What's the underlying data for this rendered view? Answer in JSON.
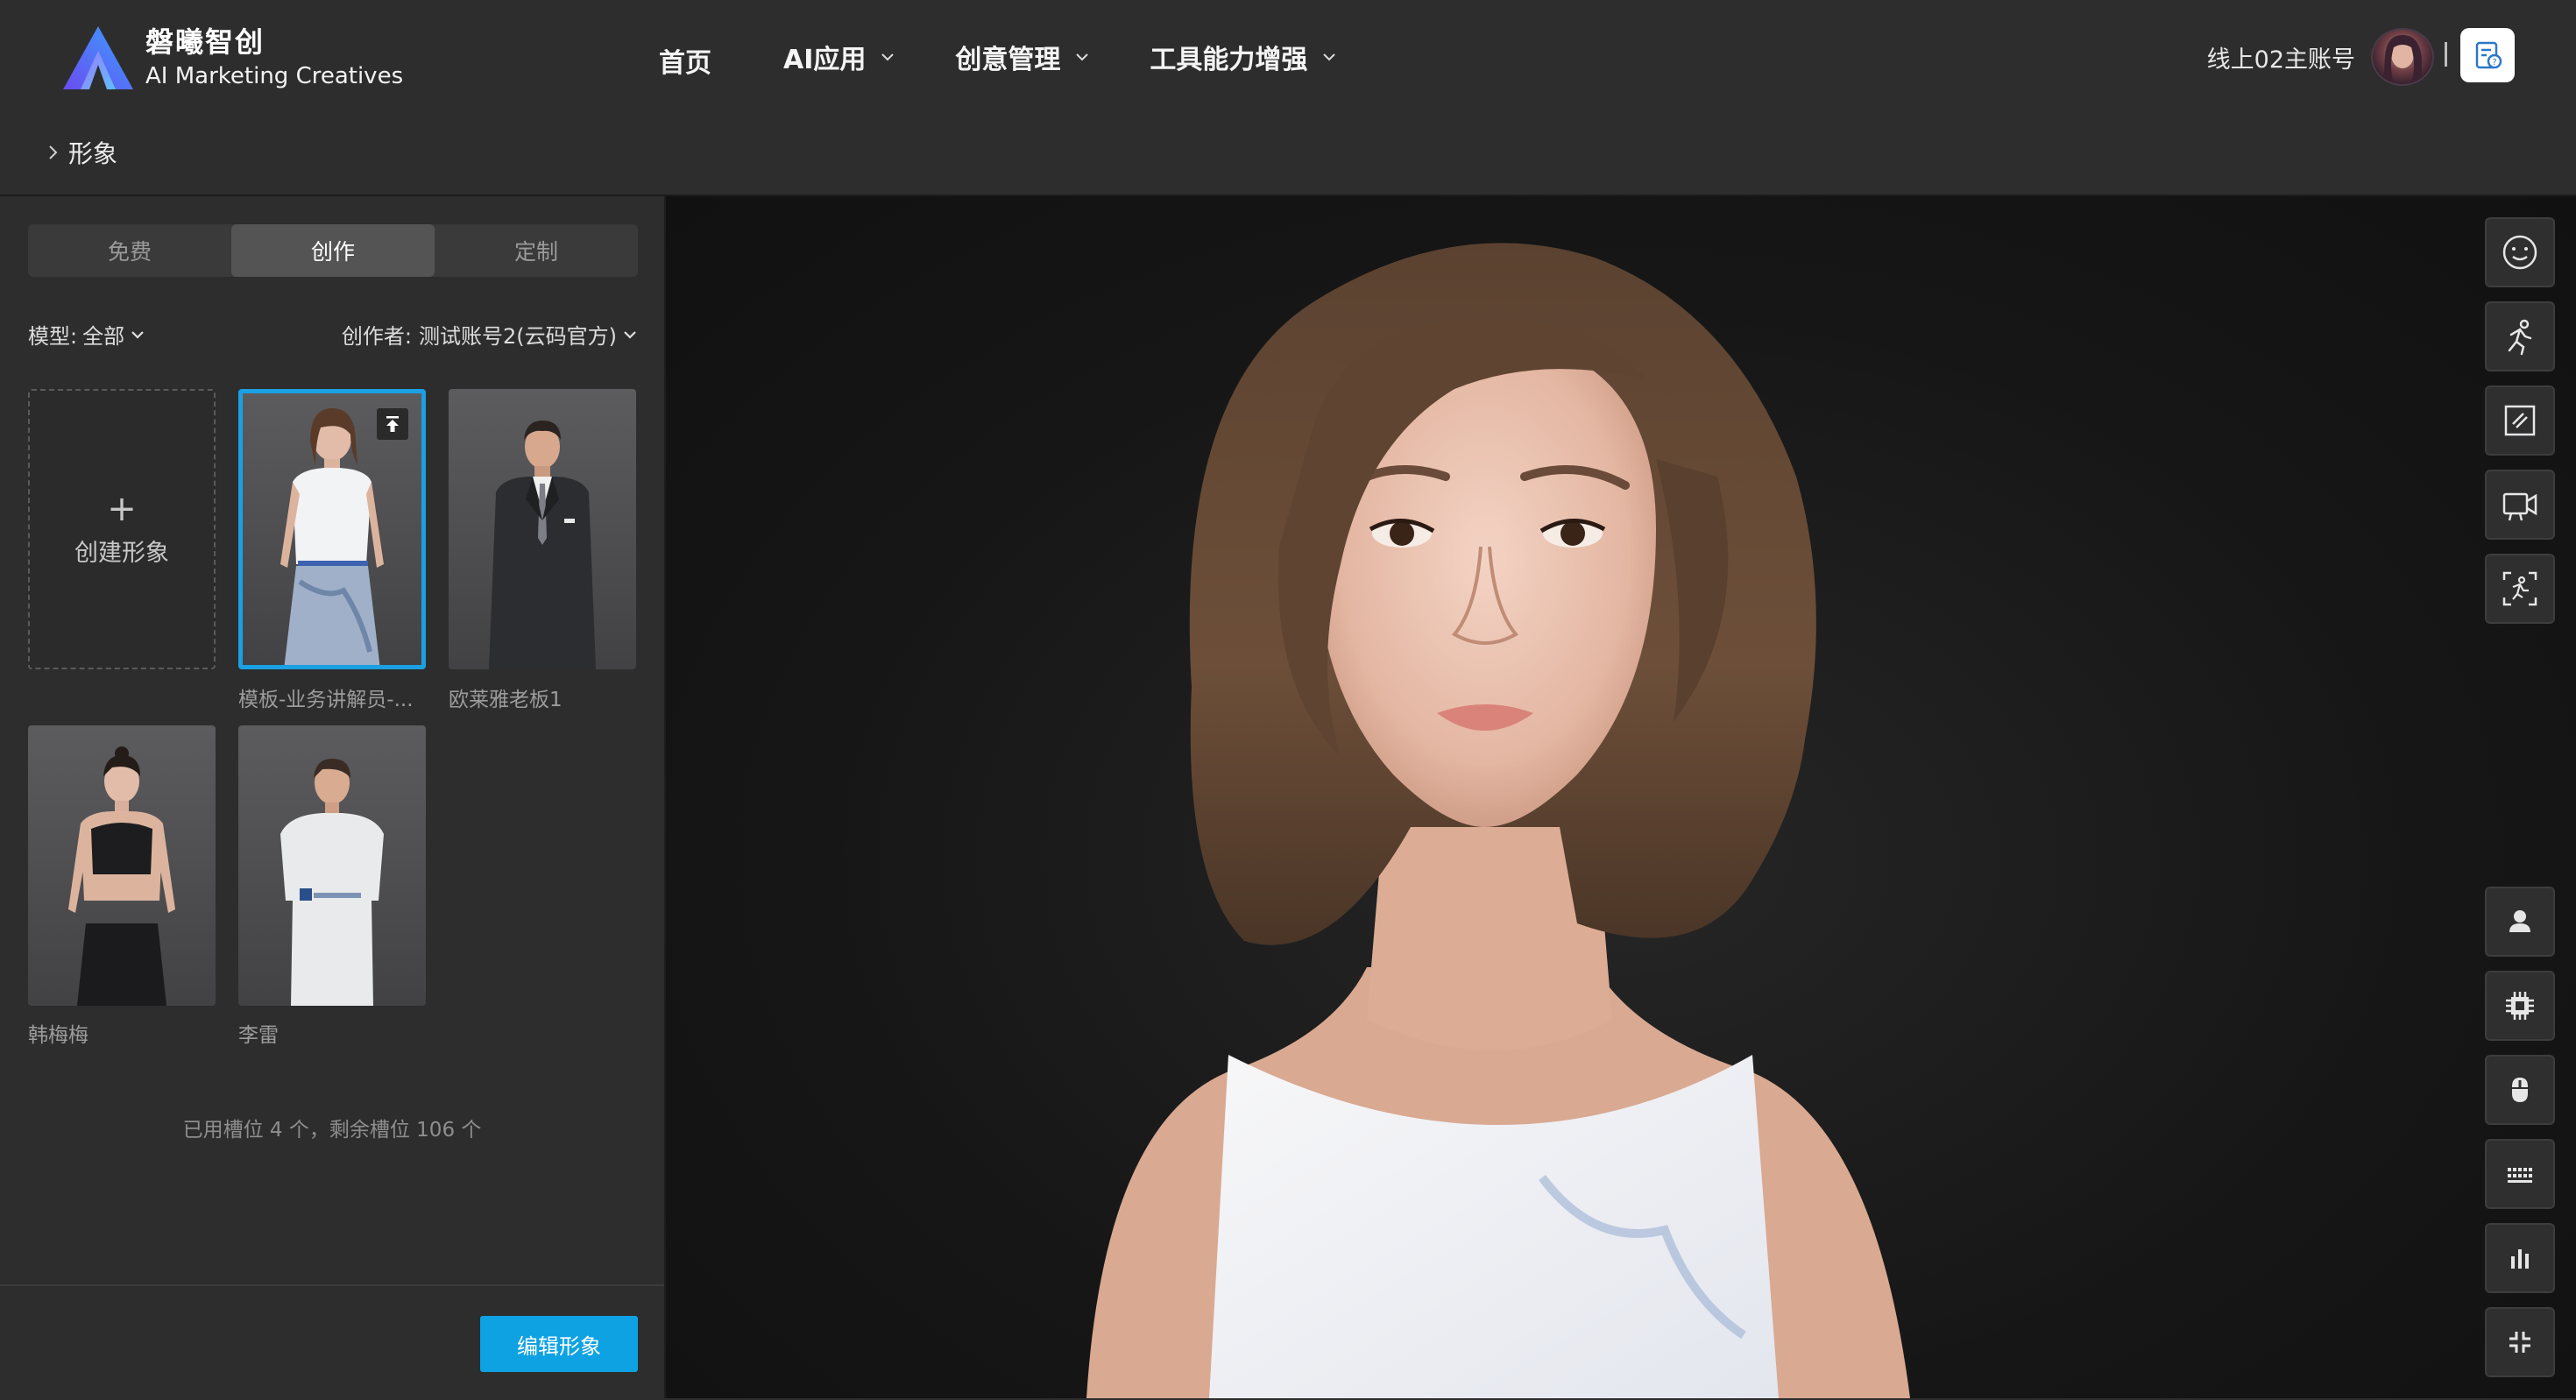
{
  "brand": {
    "name_cn": "磐曦智创",
    "name_en": "AI Marketing Creatives"
  },
  "nav": {
    "items": [
      {
        "label": "首页",
        "dropdown": false
      },
      {
        "label": "AI应用",
        "dropdown": true
      },
      {
        "label": "创意管理",
        "dropdown": true
      },
      {
        "label": "工具能力增强",
        "dropdown": true
      }
    ]
  },
  "account": {
    "name": "线上02主账号",
    "divider": "|"
  },
  "breadcrumb": {
    "current": "形象"
  },
  "tabs": [
    {
      "label": "免费",
      "active": false
    },
    {
      "label": "创作",
      "active": true
    },
    {
      "label": "定制",
      "active": false
    }
  ],
  "filters": {
    "model_label": "模型:",
    "model_value": "全部",
    "creator_label": "创作者:",
    "creator_value": "测试账号2(云码官方)"
  },
  "create_card": {
    "plus": "+",
    "label": "创建形象"
  },
  "avatars": [
    {
      "name": "模板-业务讲解员-...",
      "selected": true,
      "pinned": true
    },
    {
      "name": "欧莱雅老板1",
      "selected": false,
      "pinned": false
    },
    {
      "name": "韩梅梅",
      "selected": false,
      "pinned": false
    },
    {
      "name": "李雷",
      "selected": false,
      "pinned": false
    }
  ],
  "slots_text": "已用槽位 4 个，剩余槽位 106 个",
  "edit_button": "编辑形象",
  "viewport_tools_top": [
    "face-icon",
    "motion-icon",
    "edit-panel-icon",
    "video-icon",
    "pose-capture-icon"
  ],
  "viewport_tools_bottom": [
    "user-icon",
    "chip-icon",
    "mouse-icon",
    "keyboard-icon",
    "stats-icon",
    "collapse-icon"
  ],
  "colors": {
    "accent": "#1aa0e3",
    "button": "#0ea2e3",
    "panel": "#2d2d2e",
    "viewport": "#161616"
  }
}
